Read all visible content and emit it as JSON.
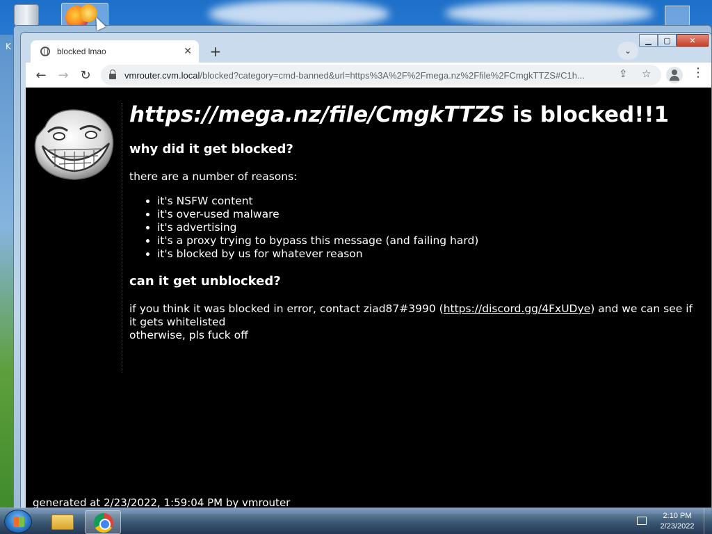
{
  "desktop": {
    "side_letter": "K"
  },
  "window": {
    "minimize_label": "▁",
    "maximize_label": "▢",
    "close_label": "✕"
  },
  "browser": {
    "tab_title": "blocked lmao",
    "tab_close": "✕",
    "new_tab": "+",
    "tab_search": "⌄",
    "back": "←",
    "forward": "→",
    "reload": "↻",
    "url_host": "vmrouter.cvm.local",
    "url_rest": "/blocked?category=cmd-banned&url=https%3A%2F%2Fmega.nz%2Ffile%2FCmgkTTZS#C1h...",
    "share_icon": "⇪",
    "bookmark_icon": "☆",
    "menu": "⋮"
  },
  "page": {
    "heading_link": "https://mega.nz/file/CmgkTTZS",
    "heading_rest": " is blocked!!1",
    "why_heading": "why did it get blocked?",
    "reasons_intro": "there are a number of reasons:",
    "reasons": [
      "it's NSFW content",
      "it's over-used malware",
      "it's advertising",
      "it's a proxy trying to bypass this message (and failing hard)",
      "it's blocked by us for whatever reason"
    ],
    "unblock_heading": "can it get unblocked?",
    "contact_before": "if you think it was blocked in error, contact ziad87#3990 (",
    "contact_link": "https://discord.gg/4FxUDye",
    "contact_after": ") and we can see if it gets whitelisted",
    "otherwise": "otherwise, pls fuck off",
    "footer": "generated at 2/23/2022, 1:59:04 PM by vmrouter"
  },
  "taskbar": {
    "time": "2:10 PM",
    "date": "2/23/2022"
  }
}
